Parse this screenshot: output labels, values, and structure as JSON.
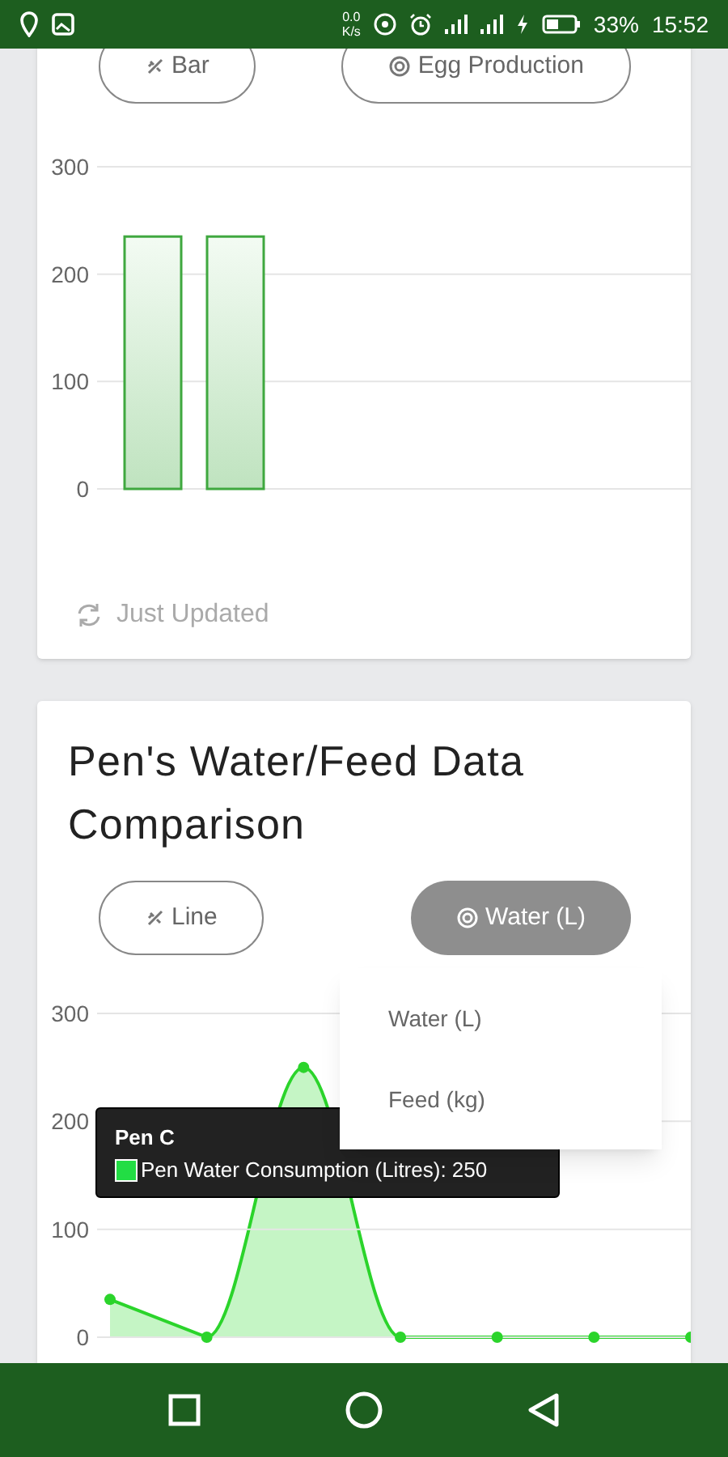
{
  "status_bar": {
    "speed": "0.0",
    "speed_unit": "K/s",
    "battery": "33%",
    "time": "15:52"
  },
  "cards": [
    {
      "buttons": [
        {
          "kind": "chart-type",
          "label": "Bar"
        },
        {
          "kind": "metric",
          "label": "Egg Production"
        }
      ],
      "chart_data": {
        "type": "bar",
        "values": [
          235,
          235,
          0,
          0,
          0,
          0,
          0
        ],
        "ylim": [
          0,
          300
        ],
        "yticks": [
          0,
          100,
          200,
          300
        ]
      },
      "footer": "Just Updated"
    },
    {
      "title": "Pen's Water/Feed Data Comparison",
      "buttons": [
        {
          "kind": "chart-type",
          "label": "Line"
        },
        {
          "kind": "metric",
          "label": "Water (L)"
        }
      ],
      "dropdown": [
        {
          "label": "Water (L)"
        },
        {
          "label": "Feed (kg)"
        }
      ],
      "chart_data": {
        "type": "area",
        "values": [
          35,
          0,
          250,
          0,
          0,
          0,
          0
        ],
        "ylim": [
          0,
          300
        ],
        "yticks": [
          0,
          100,
          200,
          300
        ]
      },
      "tooltip": {
        "title": "Pen C",
        "text": "Pen Water Consumption (Litres): 250",
        "color": "#22dd44"
      }
    }
  ]
}
